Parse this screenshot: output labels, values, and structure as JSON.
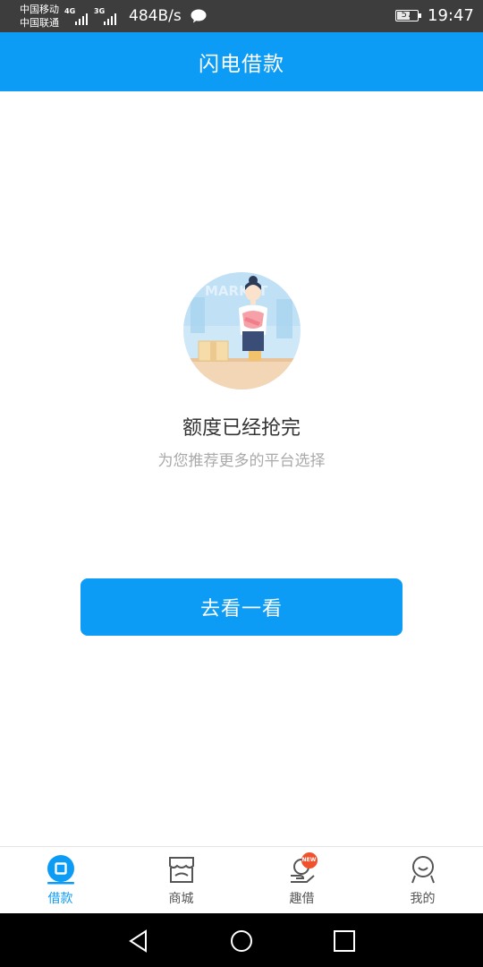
{
  "status_bar": {
    "carrier_1": "中国移动",
    "carrier_2": "中国联通",
    "net_1": "4G",
    "net_2": "3G",
    "speed": "484B/s",
    "battery": "57",
    "time": "19:47",
    "icons": [
      "signal-icon",
      "chat-bubble-icon",
      "battery-icon"
    ]
  },
  "header": {
    "title": "闪电借款"
  },
  "empty_state": {
    "illustration": "market-clerk-illustration",
    "illustration_text": "MARKET",
    "title": "额度已经抢完",
    "subtitle": "为您推荐更多的平台选择"
  },
  "action": {
    "button_label": "去看一看"
  },
  "tabs": [
    {
      "label": "借款",
      "icon": "loan-icon",
      "active": true
    },
    {
      "label": "商城",
      "icon": "shop-icon",
      "active": false
    },
    {
      "label": "趣借",
      "icon": "hand-coin-icon",
      "active": false,
      "badge": "NEW"
    },
    {
      "label": "我的",
      "icon": "profile-icon",
      "active": false
    }
  ],
  "colors": {
    "accent": "#0c9cf5",
    "status_bar": "#3d3d3d",
    "badge": "#f0522d",
    "title_text": "#333333",
    "subtitle_text": "#aaaaaa"
  }
}
